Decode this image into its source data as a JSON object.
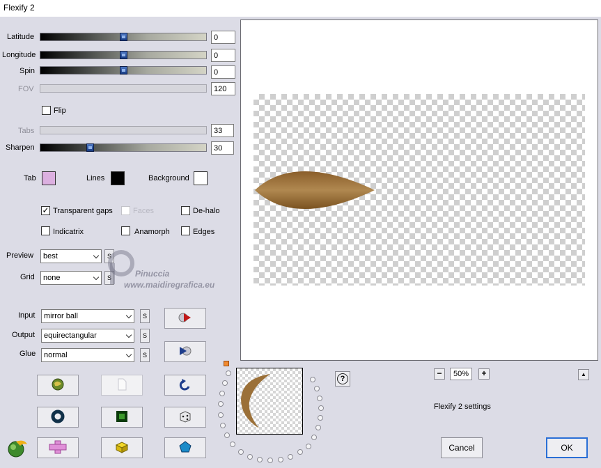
{
  "window": {
    "title": "Flexify 2"
  },
  "sliders": {
    "latitude": {
      "label": "Latitude",
      "value": "0",
      "position": 0.5,
      "disabled": false
    },
    "longitude": {
      "label": "Longitude",
      "value": "0",
      "position": 0.5,
      "disabled": false
    },
    "spin": {
      "label": "Spin",
      "value": "0",
      "position": 0.5,
      "disabled": false
    },
    "fov": {
      "label": "FOV",
      "value": "120",
      "disabled": true
    },
    "tabs": {
      "label": "Tabs",
      "value": "33",
      "disabled": true
    },
    "sharpen": {
      "label": "Sharpen",
      "value": "30",
      "position": 0.3,
      "disabled": false
    }
  },
  "flip": {
    "label": "Flip",
    "checked": false
  },
  "colors": {
    "tab": {
      "label": "Tab",
      "color": "#dcb0e0"
    },
    "lines": {
      "label": "Lines",
      "color": "#000000"
    },
    "background": {
      "label": "Background",
      "color": "#ffffff"
    }
  },
  "options": {
    "transparent_gaps": {
      "label": "Transparent gaps",
      "checked": true
    },
    "faces": {
      "label": "Faces",
      "checked": false,
      "disabled": true
    },
    "de_halo": {
      "label": "De-halo",
      "checked": false
    },
    "indicatrix": {
      "label": "Indicatrix",
      "checked": false
    },
    "anamorph": {
      "label": "Anamorph",
      "checked": false
    },
    "edges": {
      "label": "Edges",
      "checked": false
    }
  },
  "preview": {
    "label": "Preview",
    "value": "best"
  },
  "grid": {
    "label": "Grid",
    "value": "none"
  },
  "input": {
    "label": "Input",
    "value": "mirror ball"
  },
  "output": {
    "label": "Output",
    "value": "equirectangular"
  },
  "glue": {
    "label": "Glue",
    "value": "normal"
  },
  "s_label": "S",
  "zoom": {
    "value": "50%",
    "minus": "−",
    "plus": "+"
  },
  "settings_label": "Flexify 2 settings",
  "help_label": "?",
  "expand_label": "▲",
  "buttons": {
    "cancel": "Cancel",
    "ok": "OK"
  },
  "watermark": {
    "line1": "Pinuccia",
    "line2": "www.maidiregrafica.eu"
  },
  "accent_colors": {
    "leaf": "#9b7038",
    "ok_border": "#2a6fd6"
  }
}
